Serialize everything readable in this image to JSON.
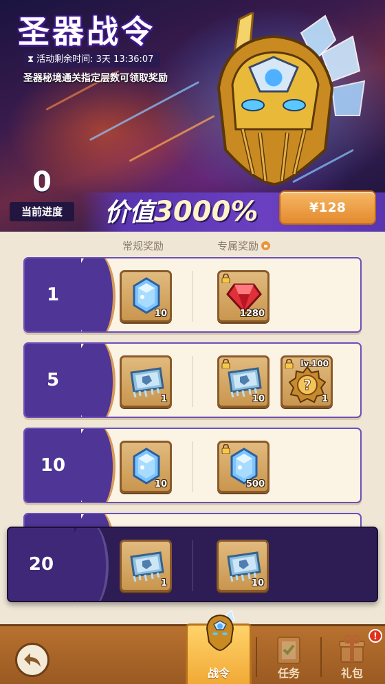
{
  "banner": {
    "title": "圣器战令",
    "timer_label": "活动剩余时间: 3天 13:36:07",
    "subtitle": "圣器秘境通关指定层数可领取奖励",
    "progress_value": "0",
    "progress_label": "当前进度",
    "value_prefix": "价值",
    "value_amount": "3000%",
    "price_label": "¥128"
  },
  "columns": {
    "regular": "常规奖励",
    "exclusive": "专属奖励"
  },
  "rows": [
    {
      "level": "1",
      "regular": [
        {
          "icon": "blue-crystal-icon",
          "qty": "10"
        }
      ],
      "exclusive": [
        {
          "icon": "red-gem-icon",
          "qty": "1280",
          "locked": true
        }
      ]
    },
    {
      "level": "5",
      "regular": [
        {
          "icon": "ice-ticket-icon",
          "qty": "1"
        }
      ],
      "exclusive": [
        {
          "icon": "ice-ticket-icon",
          "qty": "10",
          "locked": true
        },
        {
          "icon": "mystery-medal-icon",
          "qty": "1",
          "locked": true,
          "tag": "lv.100"
        }
      ]
    },
    {
      "level": "10",
      "regular": [
        {
          "icon": "blue-crystal-icon",
          "qty": "10"
        }
      ],
      "exclusive": [
        {
          "icon": "blue-crystal-icon",
          "qty": "500",
          "locked": true
        }
      ]
    }
  ],
  "current_row": {
    "level": "20",
    "regular": [
      {
        "icon": "ice-ticket-icon",
        "qty": "1"
      }
    ],
    "exclusive": [
      {
        "icon": "ice-ticket-icon",
        "qty": "10"
      }
    ]
  },
  "nav": {
    "battle_pass": "战令",
    "tasks": "任务",
    "gift_pack": "礼包",
    "gift_badge": "!"
  },
  "colors": {
    "row_level_bg": "#4e3596",
    "price_button": "#f0a040",
    "active_tab": "#f5b948"
  }
}
